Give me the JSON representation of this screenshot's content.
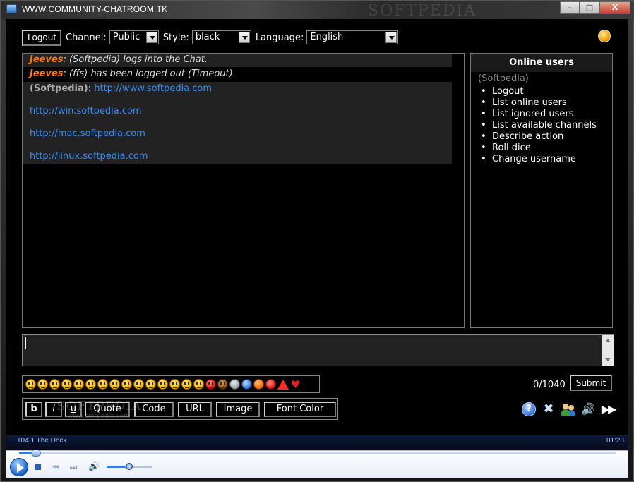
{
  "window": {
    "title": "WWW.COMMUNITY-CHATROOM.TK",
    "watermark": "SOFTPEDIA",
    "buttons": {
      "minimize": "–",
      "maximize": "□",
      "close": "X"
    }
  },
  "toolbar": {
    "logout_label": "Logout",
    "channel_label": "Channel:",
    "channel_value": "Public",
    "style_label": "Style:",
    "style_value": "black",
    "language_label": "Language:",
    "language_value": "English"
  },
  "chat": {
    "messages": [
      {
        "user": "Jeeves",
        "text": ": (Softpedia) logs into the Chat."
      },
      {
        "user": "Jeeves",
        "text": ": (ffs) has been logged out (Timeout)."
      }
    ],
    "block": {
      "user": "(Softpedia)",
      "sep": ": ",
      "links": [
        "http://www.softpedia.com",
        "http://win.softpedia.com",
        "http://mac.softpedia.com",
        "http://linux.softpedia.com"
      ]
    }
  },
  "online": {
    "title": "Online users",
    "current_user": "(Softpedia)",
    "actions": [
      "Logout",
      "List online users",
      "List ignored users",
      "List available channels",
      "Describe action",
      "Roll dice",
      "Change username"
    ]
  },
  "composer": {
    "counter": "0/1040",
    "submit_label": "Submit"
  },
  "formatting": {
    "bold": "b",
    "italic": "i",
    "underline": "u",
    "quote": "Quote",
    "code": "Code",
    "url": "URL",
    "image": "Image",
    "font_color": "Font Color",
    "watermark": "SOFTPEDIA",
    "watermark_sub": "www.softpedia.com"
  },
  "tools": {
    "help_glyph": "?",
    "tools_glyph": "✖",
    "sound_glyph": "🔊",
    "forward_glyph": "▶▶"
  },
  "player": {
    "track": "104.1 The Dock",
    "time": "01:23",
    "seek_fraction": 0.02,
    "volume_fraction": 0.5,
    "prev_glyph": "⏮",
    "next_glyph": "⏭",
    "vol_glyph": "🔊"
  },
  "colors": {
    "user_accent": "#ff7a00",
    "link": "#3b8ef0",
    "background": "#000000"
  }
}
